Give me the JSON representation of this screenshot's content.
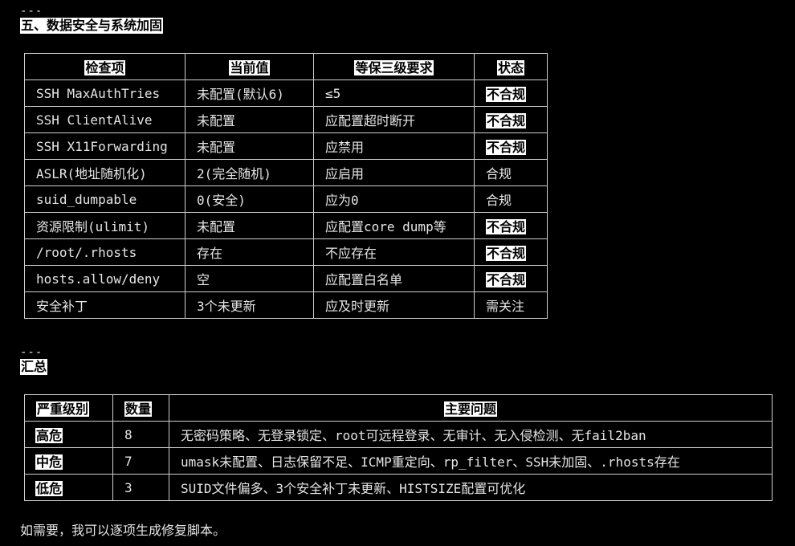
{
  "separators": {
    "top": "---",
    "middle": "---"
  },
  "section5": {
    "heading": "五、数据安全与系统加固",
    "headers": [
      "检查项",
      "当前值",
      "等保三级要求",
      "状态"
    ],
    "rows": [
      {
        "item": "SSH MaxAuthTries",
        "current": "未配置(默认6)",
        "requirement": "≤5",
        "status": "不合规",
        "flag": true
      },
      {
        "item": "SSH ClientAlive",
        "current": "未配置",
        "requirement": "应配置超时断开",
        "status": "不合规",
        "flag": true
      },
      {
        "item": "SSH X11Forwarding",
        "current": "未配置",
        "requirement": "应禁用",
        "status": "不合规",
        "flag": true
      },
      {
        "item": "ASLR(地址随机化)",
        "current": "2(完全随机)",
        "requirement": "应启用",
        "status": "合规",
        "flag": false
      },
      {
        "item": "suid_dumpable",
        "current": "0(安全)",
        "requirement": "应为0",
        "status": "合规",
        "flag": false
      },
      {
        "item": "资源限制(ulimit)",
        "current": "未配置",
        "requirement": "应配置core dump等",
        "status": "不合规",
        "flag": true
      },
      {
        "item": "/root/.rhosts",
        "current": "存在",
        "requirement": "不应存在",
        "status": "不合规",
        "flag": true
      },
      {
        "item": "hosts.allow/deny",
        "current": "空",
        "requirement": "应配置白名单",
        "status": "不合规",
        "flag": true
      },
      {
        "item": "安全补丁",
        "current": "3个未更新",
        "requirement": "应及时更新",
        "status": "需关注",
        "flag": false
      }
    ]
  },
  "summary": {
    "heading": "汇总",
    "headers": [
      "严重级别",
      "数量",
      "主要问题"
    ],
    "rows": [
      {
        "level": "高危",
        "count": "8",
        "issues": "无密码策略、无登录锁定、root可远程登录、无审计、无入侵检测、无fail2ban"
      },
      {
        "level": "中危",
        "count": "7",
        "issues": "umask未配置、日志保留不足、ICMP重定向、rp_filter、SSH未加固、.rhosts存在"
      },
      {
        "level": "低危",
        "count": "3",
        "issues": "SUID文件偏多、3个安全补丁未更新、HISTSIZE配置可优化"
      }
    ]
  },
  "footer": "如需要，我可以逐项生成修复脚本。"
}
